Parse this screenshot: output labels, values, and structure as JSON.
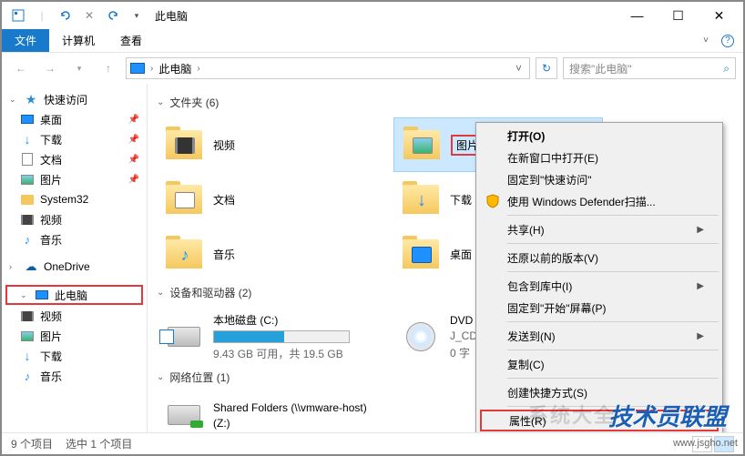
{
  "titlebar": {
    "title": "此电脑"
  },
  "ribbon": {
    "file": "文件",
    "tabs": [
      "计算机",
      "查看"
    ]
  },
  "address": {
    "crumb": "此电脑",
    "search_placeholder": "搜索\"此电脑\""
  },
  "sidebar": {
    "quick_access": "快速访问",
    "items_qa": [
      "桌面",
      "下载",
      "文档",
      "图片",
      "System32",
      "视频",
      "音乐"
    ],
    "onedrive": "OneDrive",
    "this_pc": "此电脑",
    "items_pc": [
      "视频",
      "图片",
      "下载",
      "音乐"
    ]
  },
  "content": {
    "group_folders": "文件夹 (6)",
    "folders_left": [
      "视频",
      "文档",
      "音乐"
    ],
    "folders_right": [
      "图片",
      "下载",
      "桌面"
    ],
    "group_devices": "设备和驱动器 (2)",
    "drive_c": {
      "label": "本地磁盘 (C:)",
      "usage_text": "9.43 GB 可用，共 19.5 GB",
      "fill_percent": 52
    },
    "dvd": {
      "label": "DVD",
      "sub1": "J_CD",
      "sub2": "0 字"
    },
    "group_network": "网络位置 (1)",
    "shared": {
      "label": "Shared Folders (\\\\vmware-host)",
      "sub": "(Z:)"
    }
  },
  "context_menu": {
    "open": "打开(O)",
    "open_new": "在新窗口中打开(E)",
    "pin_qa": "固定到\"快速访问\"",
    "defender": "使用 Windows Defender扫描...",
    "share": "共享(H)",
    "restore": "还原以前的版本(V)",
    "include": "包含到库中(I)",
    "pin_start": "固定到\"开始\"屏幕(P)",
    "sendto": "发送到(N)",
    "copy": "复制(C)",
    "shortcut": "创建快捷方式(S)",
    "properties": "属性(R)"
  },
  "statusbar": {
    "items": "9 个项目",
    "selected": "选中 1 个项目"
  },
  "watermarks": {
    "main": "技术员联盟",
    "url": "www.jsgho.net",
    "bg": "系统大全"
  }
}
